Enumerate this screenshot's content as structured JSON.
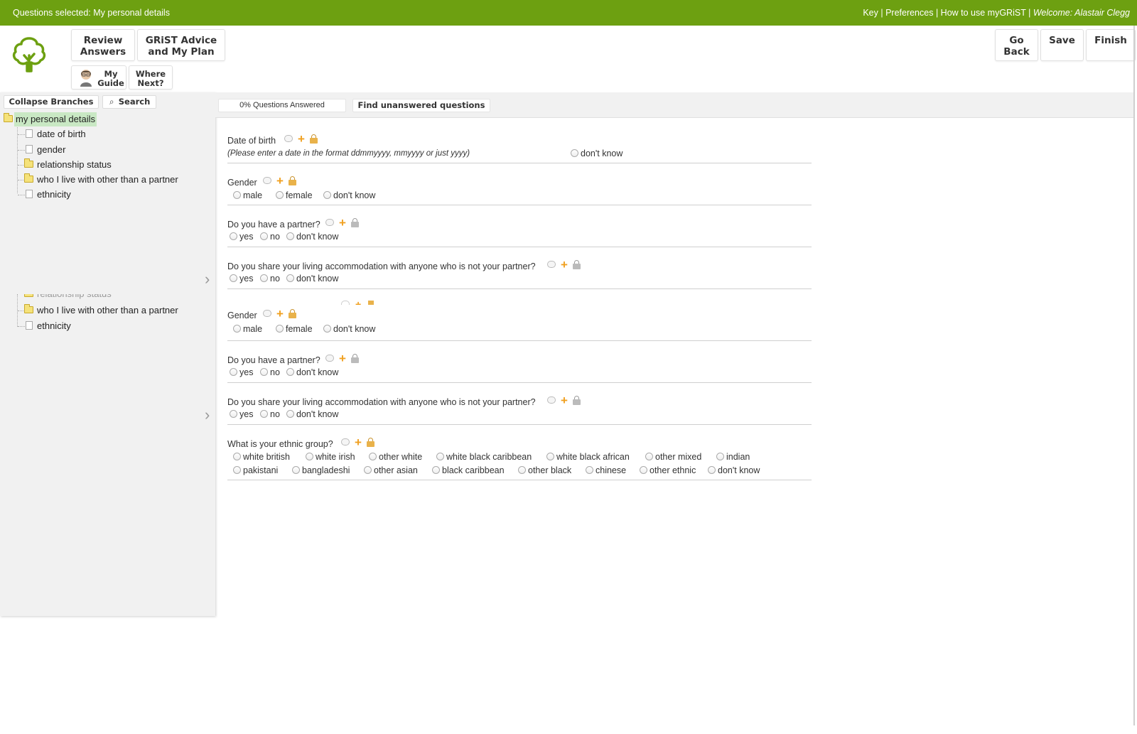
{
  "topbar": {
    "selected": "Questions selected: My personal details",
    "links": [
      "Key",
      "Preferences",
      "How to use myGRiST"
    ],
    "sep": " | ",
    "welcome": "Welcome: Alastair Clegg"
  },
  "header": {
    "review": [
      "Review",
      "Answers"
    ],
    "advice": [
      "GRiST Advice",
      "and My Plan"
    ],
    "guide": [
      "My",
      "Guide"
    ],
    "next": [
      "Where",
      "Next?"
    ],
    "goback": [
      "Go",
      "Back"
    ],
    "save": "Save",
    "finish": "Finish"
  },
  "sidebar": {
    "collapse": "Collapse Branches",
    "search": "Search",
    "tree": {
      "root": "my personal details",
      "items": [
        "date of birth",
        "gender",
        "relationship status",
        "who I live with other than a partner",
        "ethnicity"
      ]
    },
    "tree2": {
      "partial": "relationship status",
      "items": [
        "who I live with other than a partner",
        "ethnicity"
      ]
    }
  },
  "main": {
    "progress": "0% Questions Answered",
    "find": "Find unanswered questions",
    "dob": {
      "title": "Date of birth",
      "hint": "(Please enter a date in the format ddmmyyyy, mmyyyy or just yyyy)",
      "dontknow": "don't know"
    },
    "gender": {
      "title": "Gender",
      "options": [
        "male",
        "female",
        "don't know"
      ]
    },
    "partner": {
      "title": "Do you have a partner?",
      "options": [
        "yes",
        "no",
        "don't know"
      ]
    },
    "share": {
      "title": "Do you share your living accommodation with anyone who is not your partner?",
      "options": [
        "yes",
        "no",
        "don't know"
      ]
    },
    "ethnic": {
      "title": "What is your ethnic group?",
      "row1": [
        "white british",
        "white irish",
        "other white",
        "white black caribbean",
        "white black african",
        "other mixed",
        "indian"
      ],
      "row2": [
        "pakistani",
        "bangladeshi",
        "other asian",
        "black caribbean",
        "other black",
        "chinese",
        "other ethnic",
        "don't know"
      ]
    }
  },
  "colors": {
    "brand": "#6da011",
    "plus": "#f0a020",
    "highlight": "#c9e8c4"
  },
  "icons": [
    "tree-logo-icon",
    "folder-icon",
    "document-icon",
    "comment-icon",
    "plus-icon",
    "lock-icon",
    "chevron-right-icon",
    "search-icon",
    "avatar"
  ]
}
